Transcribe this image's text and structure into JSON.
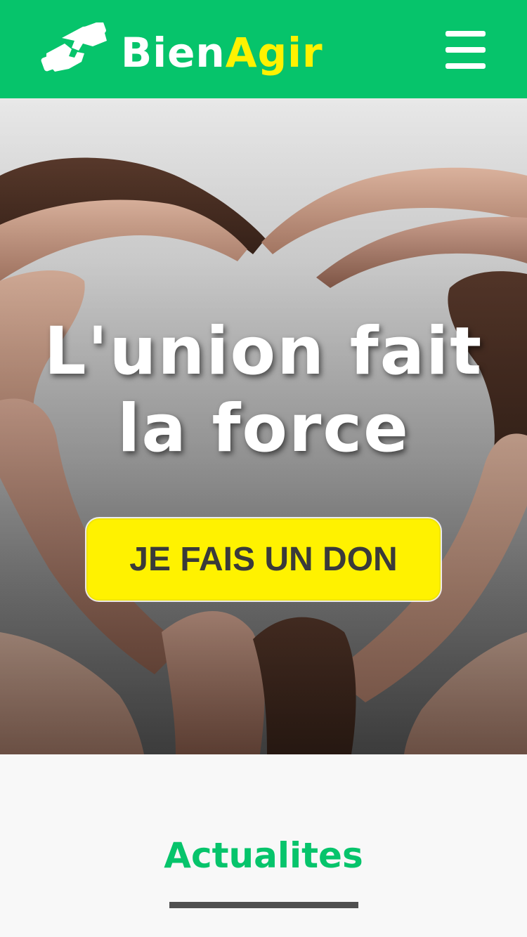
{
  "header": {
    "logo_icon": "handshake-icon",
    "brand_part1": "Bien",
    "brand_part2": "Agir",
    "menu_icon": "hamburger-menu-icon",
    "background_color": "#06c46b",
    "accent_color": "#fff200"
  },
  "hero": {
    "title_line1": "L'union fait",
    "title_line2": "la force",
    "image": "hands-forming-heart-photo",
    "cta_label": "JE FAIS UN DON",
    "cta_color": "#fff200"
  },
  "news": {
    "title": "Actualites",
    "title_color": "#06c46b"
  }
}
